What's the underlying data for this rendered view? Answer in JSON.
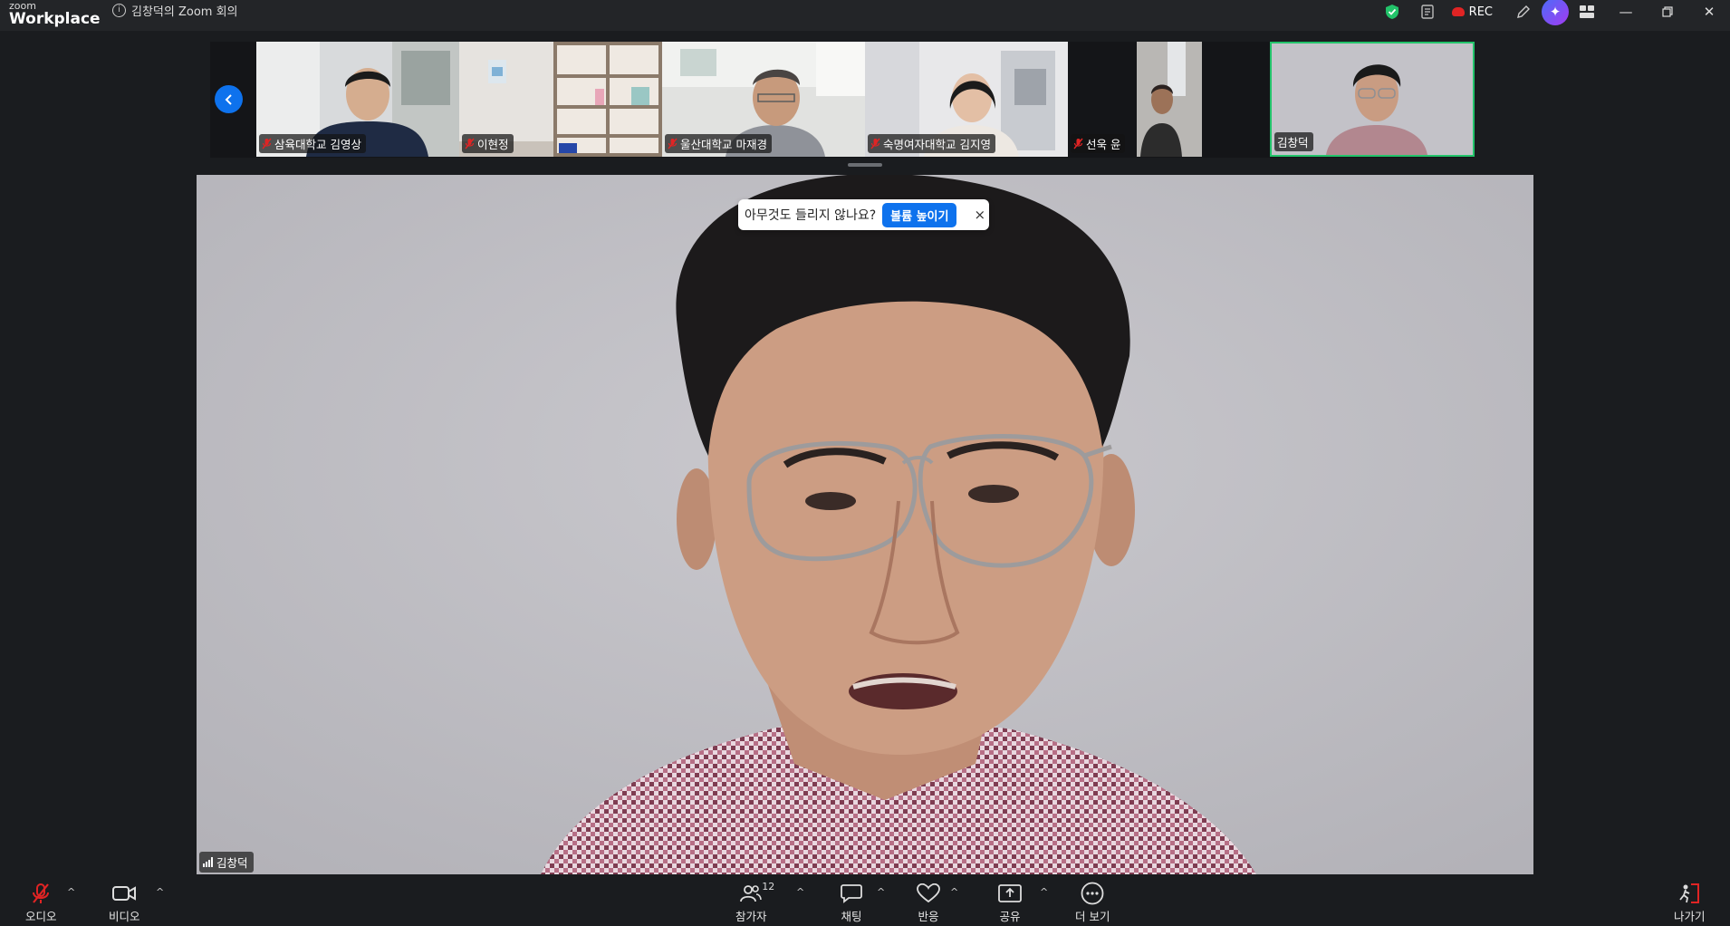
{
  "app": {
    "brand_small": "zoom",
    "brand_large": "Workplace",
    "meeting_title": "김창덕의 Zoom 회의",
    "rec_label": "REC"
  },
  "participants": [
    {
      "name": "삼육대학교 김영상",
      "muted": true
    },
    {
      "name": "이현정",
      "muted": true
    },
    {
      "name": "울산대학교 마재경",
      "muted": true
    },
    {
      "name": "숙명여자대학교 김지영",
      "muted": true
    },
    {
      "name": "선욱 윤",
      "muted": true
    },
    {
      "name": "김창덕",
      "muted": false
    }
  ],
  "main_speaker": {
    "name": "김창덕"
  },
  "audio_hint": {
    "text": "아무것도 들리지 않나요?",
    "button": "볼륨 높이기",
    "close": "×"
  },
  "toolbar": {
    "audio": "오디오",
    "video": "비디오",
    "participants": "참가자",
    "participant_count": "12",
    "chat": "채팅",
    "reactions": "반응",
    "share": "공유",
    "more": "더 보기",
    "leave": "나가기"
  },
  "colors": {
    "accent": "#0e72ed",
    "active_border": "#22c36a",
    "mute_red": "#e02424",
    "toolbar_bg": "#1a1c1f"
  }
}
